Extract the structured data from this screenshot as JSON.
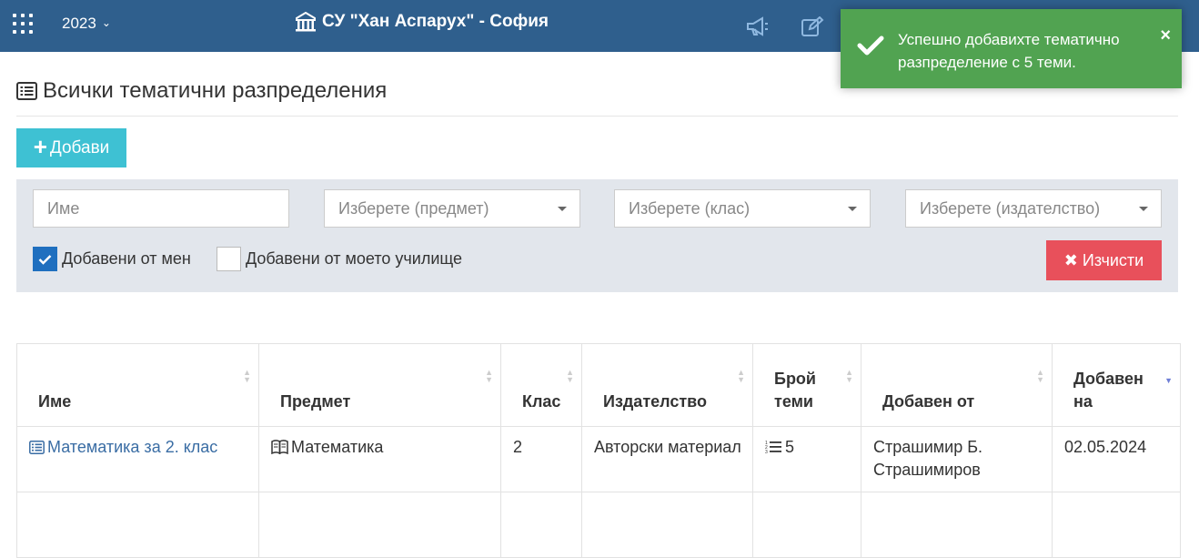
{
  "topbar": {
    "year": "2023",
    "school_name": "СУ \"Хан Аспарух\" - София",
    "bg_color": "#2f5f8d"
  },
  "toast": {
    "message": "Успешно добавихте тематично разпределение с 5 теми.",
    "close": "×",
    "bg_color": "#51a351"
  },
  "page": {
    "title": "Всички тематични разпределения",
    "add_label": "Добави"
  },
  "filters": {
    "name_placeholder": "Име",
    "subject_placeholder": "Изберете (предмет)",
    "class_placeholder": "Изберете (клас)",
    "publisher_placeholder": "Изберете (издателство)",
    "mine_label": "Добавени от мен",
    "mine_checked": true,
    "school_label": "Добавени от моето училище",
    "school_checked": false,
    "clear_label": "Изчисти"
  },
  "table": {
    "headers": {
      "name": "Име",
      "subject": "Предмет",
      "class": "Клас",
      "publisher": "Издателство",
      "topics_line1": "Брой",
      "topics_line2": "теми",
      "added_by": "Добавен от",
      "added_on_line1": "Добавен",
      "added_on_line2": "на"
    },
    "rows": [
      {
        "name": "Математика за 2. клас",
        "subject": "Математика",
        "class": "2",
        "publisher": "Авторски материал",
        "topics": "5",
        "added_by": "Страшимир Б. Страшимиров",
        "added_on": "02.05.2024"
      }
    ]
  }
}
